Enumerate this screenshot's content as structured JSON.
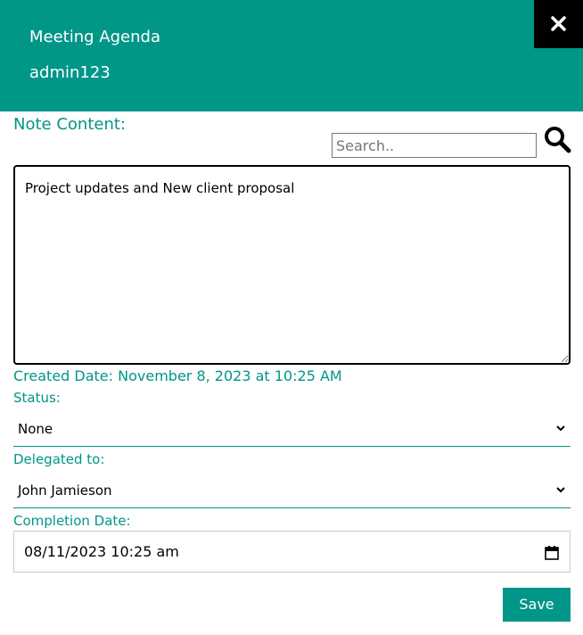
{
  "header": {
    "title": "Meeting Agenda",
    "user": "admin123"
  },
  "note": {
    "label": "Note Content:",
    "content": "Project updates and New client proposal"
  },
  "search": {
    "placeholder": "Search.."
  },
  "created": {
    "text": "Created Date: November 8, 2023 at 10:25 AM"
  },
  "status": {
    "label": "Status:",
    "value": "None"
  },
  "delegated": {
    "label": "Delegated to:",
    "value": "John Jamieson"
  },
  "completion": {
    "label": "Completion Date:",
    "value": "08/11/2023 10:25 am"
  },
  "actions": {
    "save_label": "Save"
  },
  "icons": {
    "close": "close-icon",
    "search": "search-icon",
    "dropdown": "chevron-down-icon",
    "calendar": "calendar-icon"
  },
  "colors": {
    "accent": "#009688",
    "close_bg": "#000000"
  }
}
